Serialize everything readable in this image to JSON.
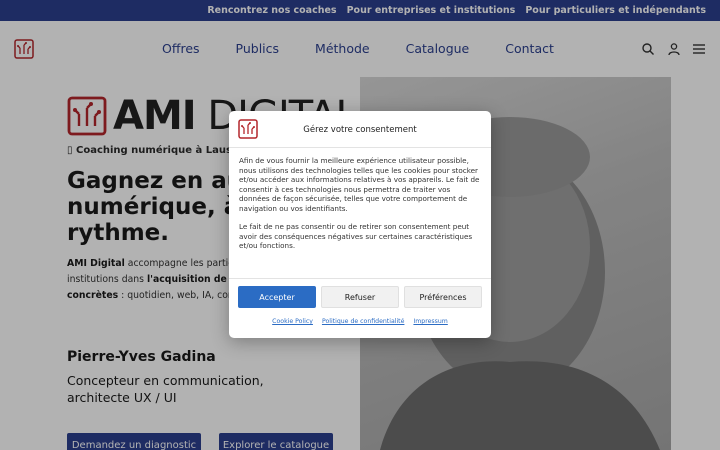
{
  "topbar": {
    "links": [
      "Rencontrez nos coaches",
      "Pour entreprises et institutions",
      "Pour particuliers et indépendants"
    ]
  },
  "header": {
    "nav": [
      "Offres",
      "Publics",
      "Méthode",
      "Catalogue",
      "Contact"
    ],
    "icons": [
      "search-icon",
      "user-icon",
      "menu-icon"
    ]
  },
  "hero": {
    "brand_bold": "AMI",
    "brand_light": "DIGITAL",
    "tagline": "▯ Coaching numérique à Lausanne",
    "headline": "Gagnez en autonomie numérique, à votre rythme.",
    "para_intro": "AMI Digital",
    "para_1": " accompagne les particuliers, entreprises et institutions dans ",
    "para_bold": "l'acquisition de compétences numériques concrètes",
    "para_2": " : quotidien, web, IA, communication et organisation.",
    "person_name": "Pierre-Yves Gadina",
    "person_role": "Concepteur en communication, architecte UX / UI",
    "btn_diagnostic": "Demandez un diagnostic",
    "btn_catalogue": "Explorer le catalogue"
  },
  "consent": {
    "title": "Gérez votre consentement",
    "body_1": "Afin de vous fournir la meilleure expérience utilisateur possible, nous utilisons des technologies telles que les cookies pour stocker et/ou accéder aux informations relatives à vos appareils. Le fait de consentir à ces technologies nous permettra de traiter vos données de façon sécurisée, telles que votre comportement de navigation ou vos identifiants.",
    "body_2": "Le fait de ne pas consentir ou de retirer son consentement peut avoir des conséquences négatives sur certaines caractéristiques et/ou fonctions.",
    "accept": "Accepter",
    "refuse": "Refuser",
    "preferences": "Préférences",
    "links": [
      "Cookie Policy",
      "Politique de confidentialité",
      "Impressum"
    ]
  },
  "colors": {
    "brand_blue": "#2b3f8f",
    "accept_blue": "#2b6cc4",
    "logo_red": "#b3262b"
  }
}
